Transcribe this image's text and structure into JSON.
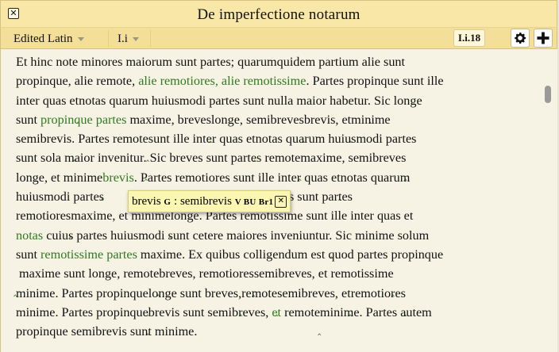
{
  "window": {
    "title": "De imperfectione notarum",
    "close_glyph": "✕"
  },
  "toolbar": {
    "edition_label": "Edited Latin",
    "section_label": "I.i",
    "reference": "I.i.18",
    "settings_icon": "gear-icon",
    "add_icon": "plus-icon"
  },
  "text_lines": [
    [
      {
        "t": "Et hinc note minores maiorum sunt partes; quarumquidem partium alie sunt"
      }
    ],
    [
      {
        "t": "propinque, alie remote, "
      },
      {
        "t": "alie remotiores, alie remotissime",
        "g": true
      },
      {
        "t": ". Partes propinque sunt ille"
      }
    ],
    [
      {
        "t": "inter quas et"
      },
      {
        "c": true
      },
      {
        "t": "notas quarum huiusmodi partes sunt nulla maior habetur."
      },
      {
        "c": true
      },
      {
        "t": " Sic longe"
      }
    ],
    [
      {
        "t": "sunt "
      },
      {
        "t": "propinque partes",
        "g": true
      },
      {
        "t": " maxime, breves"
      },
      {
        "c": true
      },
      {
        "t": "longe, semibreves"
      },
      {
        "c": true
      },
      {
        "t": "brevis, et"
      },
      {
        "c": true
      },
      {
        "t": "minime"
      }
    ],
    [
      {
        "t": "semibrevis."
      },
      {
        "c": true
      },
      {
        "t": " Partes remote"
      },
      {
        "c": true
      },
      {
        "t": "sunt ille inter quas et"
      },
      {
        "c": true
      },
      {
        "t": "notas quarum huiusmodi partes"
      }
    ],
    [
      {
        "t": "sunt sola maior invenitur."
      },
      {
        "c": true
      },
      {
        "t": " Sic breves sunt partes remote"
      },
      {
        "c": true
      },
      {
        "t": "maxime, semibreves"
      },
      {
        "c": true
      }
    ],
    [
      {
        "t": "longe, et minime"
      },
      {
        "c": true
      },
      {
        "t": "brevis",
        "g": true
      },
      {
        "t": ". Partes remotiores sunt ille inter quas et"
      },
      {
        "c": true
      },
      {
        "t": "notas quarum"
      }
    ],
    [
      {
        "t": "huiusmodi partes"
      },
      {
        "t": "                                   "
      },
      {
        "t": "Sic semibreves sunt partes"
      }
    ],
    [
      {
        "t": "remotiores"
      },
      {
        "c": true
      },
      {
        "t": "maxime, et minime"
      },
      {
        "c": true
      },
      {
        "t": "longe. Partes remotissime sunt ille inter quas et"
      }
    ],
    [
      {
        "t": "notas",
        "g": true
      },
      {
        "t": " cuius partes huiusmodi sunt cetere maiores inveniuntur."
      },
      {
        "c": true
      },
      {
        "t": " Sic minime solum"
      }
    ],
    [
      {
        "t": "sunt "
      },
      {
        "t": "remotissime partes",
        "g": true
      },
      {
        "t": " maxime. Ex quibus colligendum est quod partes propinque"
      }
    ],
    [
      {
        "c": true
      },
      {
        "t": " maxime sunt longe, remote"
      },
      {
        "c": true
      },
      {
        "t": "breves, remotiores"
      },
      {
        "c": true
      },
      {
        "t": "semibreves, et remotissime"
      },
      {
        "c": true
      }
    ],
    [
      {
        "t": "minime. Partes propinque"
      },
      {
        "c": true
      },
      {
        "t": "longe sunt breves,"
      },
      {
        "c": true
      },
      {
        "t": "remote"
      },
      {
        "c": true
      },
      {
        "t": "semibreves, et"
      },
      {
        "c": true
      },
      {
        "t": "remotiores"
      },
      {
        "c": true
      }
    ],
    [
      {
        "t": "minime. Partes propinque"
      },
      {
        "c": true
      },
      {
        "t": "brevis sunt semibreves, "
      },
      {
        "t": "et",
        "g": true
      },
      {
        "t": " remote"
      },
      {
        "c": true
      },
      {
        "t": "minime. Partes autem"
      }
    ],
    [
      {
        "t": "propinque semibrevis sunt minime."
      }
    ]
  ],
  "tooltip": {
    "word": "brevis",
    "sigla_g": "G",
    "separator": ":",
    "variant": "semibrevis",
    "sigla_rest": "V BU Br1",
    "close_glyph": "✕"
  }
}
